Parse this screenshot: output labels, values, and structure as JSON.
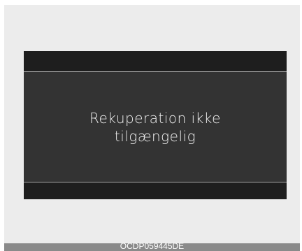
{
  "display": {
    "message_line1": "Rekuperation ikke",
    "message_line2": "tilgængelig"
  },
  "caption": {
    "code": "OCDP059445DE"
  },
  "colors": {
    "page_background": "#ececec",
    "display_background": "#333333",
    "display_bars": "#1e1e1e",
    "divider_lines": "#a4a4a4",
    "message_text": "#f0f0f0",
    "caption_bar": "#8a8a8a"
  }
}
